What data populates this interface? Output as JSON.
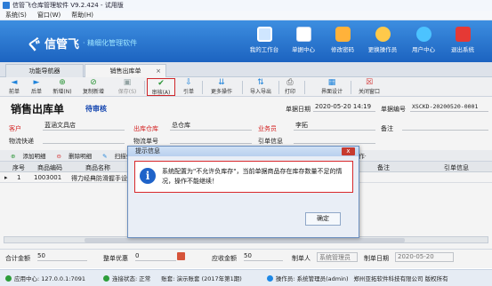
{
  "window": {
    "title": "信管飞仓库管理软件 V9.2.424 - 试用版"
  },
  "menu": [
    "系统(S)",
    "窗口(W)",
    "帮助(H)"
  ],
  "banner": {
    "logo_mark": "ぐ",
    "brand": "信管飞",
    "tagline": "· 精细化管理软件"
  },
  "topnav": [
    {
      "label": "我的工作台",
      "color": "#cfe6ff"
    },
    {
      "label": "单据中心",
      "color": "#ffffff"
    },
    {
      "label": "修改密码",
      "color": "#ffb23a"
    },
    {
      "label": "更换操作员",
      "color": "#ffc94a"
    },
    {
      "label": "用户中心",
      "color": "#4cc3ff"
    },
    {
      "label": "退出系统",
      "color": "#e53935"
    }
  ],
  "tabs": [
    {
      "label": "功能导航器"
    },
    {
      "label": "销售出库单",
      "close": "×"
    }
  ],
  "toolbar": [
    {
      "label": "前单",
      "icon": "◄",
      "color": "#1e88e5"
    },
    {
      "label": "后单",
      "icon": "►",
      "color": "#1e88e5"
    },
    {
      "label": "新增(N)",
      "icon": "⊕",
      "color": "#2e9d3a"
    },
    {
      "label": "复制新增",
      "icon": "⊘",
      "color": "#2e9d3a"
    },
    {
      "label": "保存(S)",
      "icon": "▣",
      "color": "#9aa"
    },
    {
      "label": "审核(A)",
      "icon": "✔",
      "color": "#2e9d3a"
    },
    {
      "label": "引单",
      "icon": "⇩",
      "color": "#1e88e5"
    },
    {
      "label": "更多操作",
      "icon": "⇊",
      "color": "#1e88e5"
    },
    {
      "label": "导入导出",
      "icon": "⇅",
      "color": "#1e88e5"
    },
    {
      "label": "打印",
      "icon": "⎙",
      "color": "#555"
    },
    {
      "label": "界面设计",
      "icon": "▦",
      "color": "#1e88e5"
    },
    {
      "label": "关闭窗口",
      "icon": "☒",
      "color": "#d33"
    }
  ],
  "doc": {
    "title": "销售出库单",
    "status": "待审核",
    "date_label": "单据日期",
    "date_value": "2020-05-20 14:19",
    "no_label": "单据编号",
    "no_value": "XSCKD-20200520-0001",
    "customer_label": "客户",
    "customer_value": "蓝涵文具店",
    "warehouse_label": "出库仓库",
    "warehouse_value": "总仓库",
    "clerk_label": "业务员",
    "clerk_value": "李拓",
    "remark_label": "备注",
    "express_label": "物流快递",
    "logistics_no_label": "物流单号",
    "ref_label": "引单信息"
  },
  "gridbar": {
    "add": "添加明细",
    "delete": "删除明细",
    "scan": "扫描条形码(Ctrl",
    "op": "作·"
  },
  "grid": {
    "headers": [
      "序号",
      "商品编码",
      "商品名称",
      "备注",
      "引单信息"
    ],
    "rows": [
      {
        "arrow": "▸",
        "idx": "1",
        "code": "1003001",
        "name": "得力经典防滑握手设"
      }
    ],
    "total_qty": "50"
  },
  "totals": {
    "sum_label": "合计金额",
    "sum_value": "50",
    "discount_label": "整单优惠",
    "discount_value": "0",
    "receivable_label": "应收金额",
    "receivable_value": "50",
    "maker_label": "制单人",
    "maker_value": "系统管理员",
    "make_date_label": "制单日期",
    "make_date_value": "2020-05-20"
  },
  "statusbar": [
    {
      "text": "应用中心: 127.0.0.1:7091",
      "color": "#2e9d3a"
    },
    {
      "text": "连接状态: 正常",
      "color": "#2e9d3a"
    },
    {
      "text": "账套: 演示账套 (2017年第1期)",
      "color": ""
    },
    {
      "text": "操作员: 系统管理员(admin)",
      "color": "#1e88e5"
    },
    {
      "text": "郑州亚拓软件科技有限公司 版权所有",
      "color": ""
    }
  ],
  "dialog": {
    "title": "提示信息",
    "close": "x",
    "icon": "i",
    "message": "系统配置为\"不允许负库存\"，当前单据商品存在库存数量不足的情况，操作不能继续！",
    "ok": "确定"
  }
}
